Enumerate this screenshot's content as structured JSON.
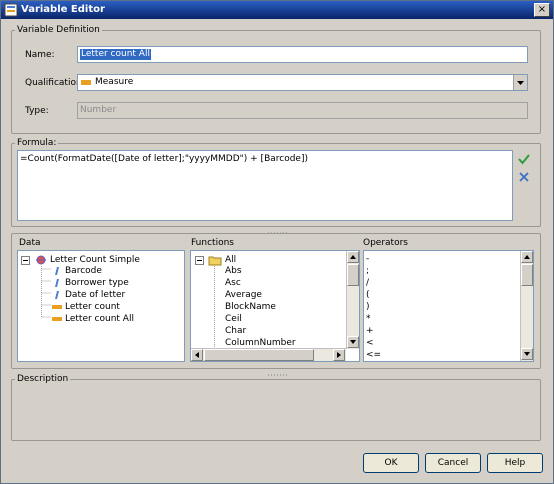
{
  "window": {
    "title": "Variable Editor",
    "close_label": "×"
  },
  "variable_definition": {
    "group_label": "Variable Definition",
    "name_label": "Name:",
    "name_value": "Letter count All",
    "qualification_label": "Qualification:",
    "qualification_value": "Measure",
    "type_label": "Type:",
    "type_placeholder": "Number"
  },
  "formula": {
    "group_label": "Formula:",
    "text": "=Count(FormatDate([Date of letter];\"yyyyMMDD\") + [Barcode])",
    "validate_icon": "checkmark-icon",
    "clear_icon": "cross-icon"
  },
  "data_panel": {
    "label": "Data",
    "root": "Letter Count Simple",
    "items": [
      {
        "label": "Barcode",
        "icon": "dimension-icon"
      },
      {
        "label": "Borrower type",
        "icon": "dimension-icon"
      },
      {
        "label": "Date of letter",
        "icon": "dimension-icon"
      },
      {
        "label": "Letter count",
        "icon": "measure-icon"
      },
      {
        "label": "Letter count All",
        "icon": "measure-icon"
      }
    ]
  },
  "functions_panel": {
    "label": "Functions",
    "root": "All",
    "items": [
      "Abs",
      "Asc",
      "Average",
      "BlockName",
      "Ceil",
      "Char",
      "ColumnNumber"
    ]
  },
  "operators_panel": {
    "label": "Operators",
    "items": [
      "-",
      ";",
      "/",
      "(",
      ")",
      "*",
      "+",
      "<",
      "<="
    ]
  },
  "description": {
    "group_label": "Description"
  },
  "buttons": {
    "ok": "OK",
    "cancel": "Cancel",
    "help": "Help"
  },
  "colors": {
    "titlebar": "#0a246a",
    "dialog_bg": "#d4d0c8",
    "selection": "#316ac5",
    "measure": "#e8a020",
    "dimension": "#4a7fd0"
  }
}
